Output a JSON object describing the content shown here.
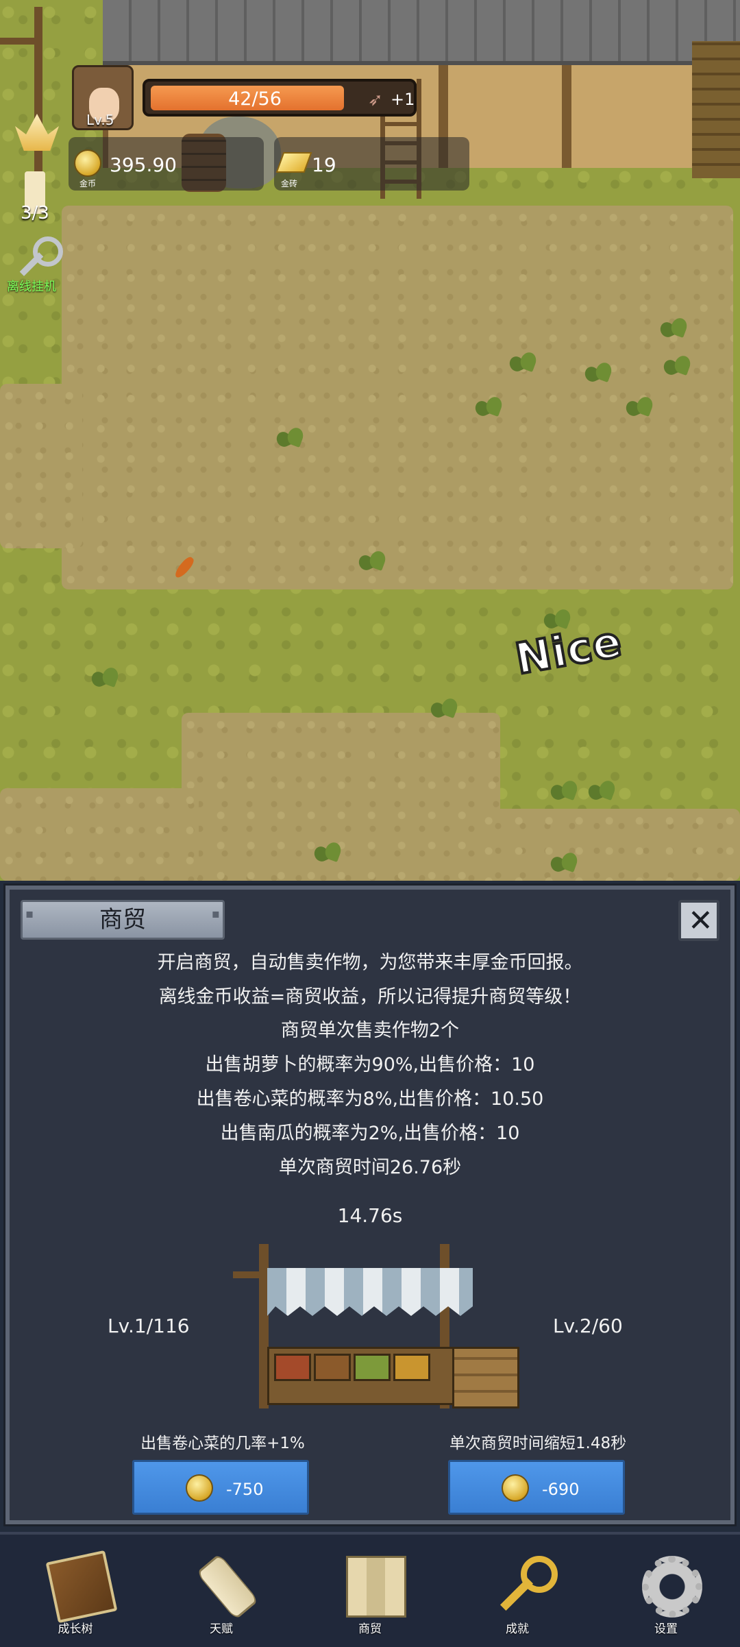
{
  "hud": {
    "level": "Lv.5",
    "xp_text": "42/56",
    "xp_fraction": 0.75,
    "xp_bonus": "+1",
    "gold_amount": "395.90",
    "gold_label": "金币",
    "brick_amount": "19",
    "brick_label": "金砖",
    "candle_count": "3/3",
    "idle_label": "离线挂机"
  },
  "scene": {
    "popup_text": "Nice"
  },
  "trade_panel": {
    "title": "商贸",
    "description_lines": [
      "开启商贸，自动售卖作物，为您带来丰厚金币回报。",
      "离线金币收益=商贸收益，所以记得提升商贸等级！",
      "商贸单次售卖作物2个",
      "出售胡萝卜的概率为90%,出售价格：10",
      "出售卷心菜的概率为8%,出售价格：10.50",
      "出售南瓜的概率为2%,出售价格：10",
      "单次商贸时间26.76秒"
    ],
    "timer": "14.76s",
    "left_level": "Lv.1/116",
    "right_level": "Lv.2/60",
    "left_upgrade": {
      "perk": "出售卷心菜的几率+1%",
      "cost": "-750"
    },
    "right_upgrade": {
      "perk": "单次商贸时间缩短1.48秒",
      "cost": "-690"
    }
  },
  "nav": {
    "items": [
      {
        "label": "成长树",
        "icon": "book-icon"
      },
      {
        "label": "天赋",
        "icon": "scroll-icon"
      },
      {
        "label": "商贸",
        "icon": "map-icon"
      },
      {
        "label": "成就",
        "icon": "key-icon"
      },
      {
        "label": "设置",
        "icon": "gear-icon"
      }
    ]
  },
  "colors": {
    "panel_bg": "#2e3442",
    "button_blue": "#4a8fe4",
    "xp_orange": "#ee8440",
    "idle_green": "#7cff5a"
  }
}
